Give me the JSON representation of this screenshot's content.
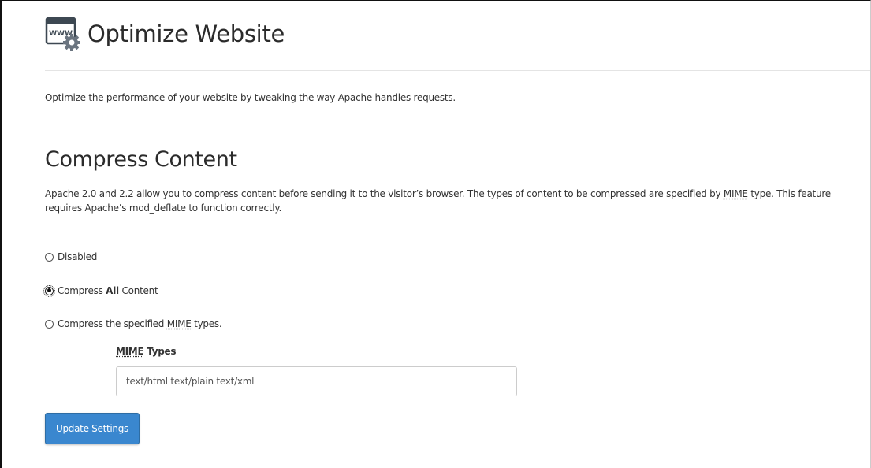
{
  "header": {
    "icon": "www-gear-icon",
    "title": "Optimize Website"
  },
  "intro": "Optimize the performance of your website by tweaking the way Apache handles requests.",
  "compress": {
    "title": "Compress Content",
    "description_part1": "Apache 2.0 and 2.2 allow you to compress content before sending it to the visitor’s browser. The types of content to be compressed are specified by ",
    "description_abbr": "MIME",
    "description_part2": " type. This feature requires Apache’s mod_deflate to function correctly.",
    "options": {
      "disabled": "Disabled",
      "all_prefix": "Compress ",
      "all_bold": "All",
      "all_suffix": " Content",
      "specified_prefix": "Compress the specified ",
      "specified_abbr": "MIME",
      "specified_suffix": " types."
    },
    "selected_option": "all",
    "mime_label_abbr": "MIME",
    "mime_label_suffix": " Types",
    "mime_value": "text/html text/plain text/xml"
  },
  "button": {
    "update_label": "Update Settings",
    "color": "#3a87cf"
  }
}
